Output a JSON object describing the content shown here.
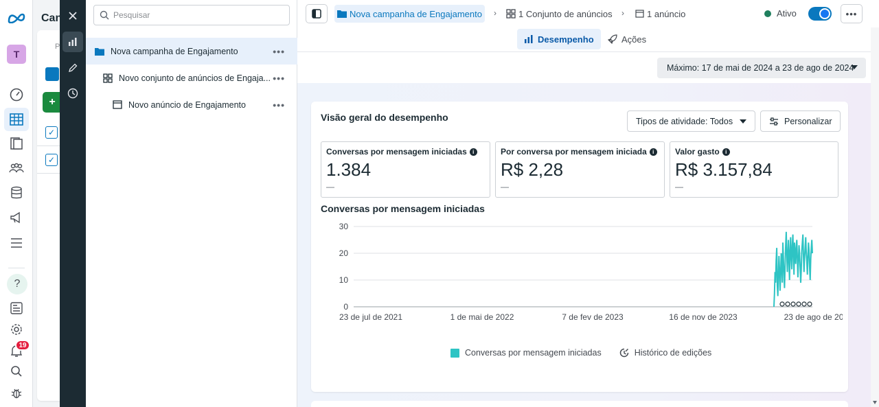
{
  "app": {
    "brand_icon": "meta-logo-icon"
  },
  "rail": {
    "avatar_letter": "T",
    "notifications_count": "19"
  },
  "background_panel": {
    "title": "Can",
    "placeholder_fragment": "P"
  },
  "tree": {
    "search_placeholder": "Pesquisar",
    "items": [
      {
        "label": "Nova campanha de Engajamento",
        "level": 0,
        "selected": true
      },
      {
        "label": "Novo conjunto de anúncios de Engaja...",
        "level": 1,
        "selected": false
      },
      {
        "label": "Novo anúncio de Engajamento",
        "level": 2,
        "selected": false
      }
    ]
  },
  "breadcrumb": {
    "campaign": "Nova campanha de Engajamento",
    "adset": "1 Conjunto de anúncios",
    "ad": "1 anúncio"
  },
  "status": {
    "label": "Ativo",
    "toggle_on": true
  },
  "tabs": {
    "performance": "Desempenho",
    "actions": "Ações"
  },
  "date_range": "Máximo: 17 de mai de 2024 a 23 de ago de 2024",
  "overview": {
    "title": "Visão geral do desempenho",
    "activity_filter": "Tipos de atividade: Todos",
    "customize": "Personalizar",
    "metrics": [
      {
        "label": "Conversas por mensagem iniciadas",
        "value": "1.384",
        "delta": "—"
      },
      {
        "label": "Por conversa por mensagem iniciada",
        "value": "R$ 2,28",
        "delta": "—"
      },
      {
        "label": "Valor gasto",
        "value": "R$ 3.157,84",
        "delta": "—"
      }
    ],
    "chart_title": "Conversas por mensagem iniciadas",
    "legend_series": "Conversas por mensagem iniciadas",
    "legend_history": "Histórico de edições"
  },
  "colors": {
    "accent": "#0a78be",
    "series": "#2ec4c4",
    "active_dot": "#1f7f5e",
    "badge": "#e41e3f"
  },
  "chart_data": {
    "type": "line",
    "title": "Conversas por mensagem iniciadas",
    "xlabel": "",
    "ylabel": "",
    "ylim": [
      0,
      30
    ],
    "yticks": [
      0,
      10,
      20,
      30
    ],
    "xtick_labels": [
      "23 de jul de 2021",
      "1 de mai de 2022",
      "7 de fev de 2023",
      "16 de nov de 2023",
      "23 de ago de 20"
    ],
    "grid": true,
    "legend_position": "bottom",
    "series": [
      {
        "name": "Conversas por mensagem iniciadas",
        "x_start": "2024-05-17",
        "x_end": "2024-08-23",
        "values": [
          0,
          5,
          13,
          9,
          17,
          22,
          8,
          4,
          12,
          19,
          14,
          6,
          11,
          20,
          16,
          9,
          24,
          18,
          12,
          7,
          15,
          22,
          28,
          20,
          13,
          19,
          25,
          17,
          10,
          21,
          26,
          18,
          14,
          23,
          27,
          19,
          12,
          24,
          20,
          16,
          22,
          25,
          18,
          11,
          17,
          23,
          20,
          15,
          9,
          14,
          21,
          24,
          27,
          19,
          13,
          18,
          22,
          26,
          20,
          17,
          12,
          19,
          24,
          21,
          15,
          10,
          18,
          22,
          25,
          20
        ]
      }
    ]
  }
}
